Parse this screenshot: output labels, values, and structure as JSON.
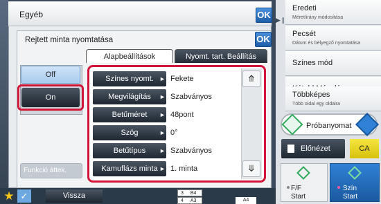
{
  "header": {
    "title": "Egyéb",
    "ok_label": "OK"
  },
  "dialog": {
    "title": "Rejtett minta nyomtatása",
    "ok_label": "OK"
  },
  "tabs": [
    {
      "label": "Alapbeállítások"
    },
    {
      "label": "Nyomt. tart. Beállítás"
    }
  ],
  "toggle": {
    "off_label": "Off",
    "on_label": "On",
    "selected": "On"
  },
  "function_button": {
    "label": "Funkció áttek."
  },
  "settings": [
    {
      "label": "Színes nyomt.",
      "value": "Fekete"
    },
    {
      "label": "Megvilágítás",
      "value": "Szabványos"
    },
    {
      "label": "Betűméret",
      "value": "48pont"
    },
    {
      "label": "Szög",
      "value": "0°"
    },
    {
      "label": "Betűtípus",
      "value": "Szabványos"
    },
    {
      "label": "Kamuflázs minta",
      "value": "1. minta"
    }
  ],
  "right_panel": {
    "items": [
      {
        "title": "Eredeti",
        "subtitle": "Méret/irány módosítása"
      },
      {
        "title": "Pecsét",
        "subtitle": "Dátum és bélyegző nyomtatása"
      },
      {
        "title": "Színes mód",
        "subtitle": ""
      },
      {
        "title": "Kétold.Másolás",
        "subtitle": ""
      },
      {
        "title": "Többképes",
        "subtitle": "Több oldal egy oldalra"
      }
    ],
    "preview_label": "Próbanyomat",
    "elonezet_label": "Előnézet",
    "ca_label": "CA",
    "start_ff": {
      "line1": "F/F",
      "line2": "Start"
    },
    "start_color": {
      "line1": "Szín",
      "line2": "Start"
    }
  },
  "bottom": {
    "back_label": "Vissza",
    "trays": [
      {
        "num": "3",
        "size": "B4"
      },
      {
        "num": "4",
        "size": "A3"
      }
    ],
    "paper_size": "A4"
  },
  "colors": {
    "accent_blue": "#1d5ea8",
    "highlight_red": "#d2163a",
    "ca_yellow": "#e8d520"
  }
}
